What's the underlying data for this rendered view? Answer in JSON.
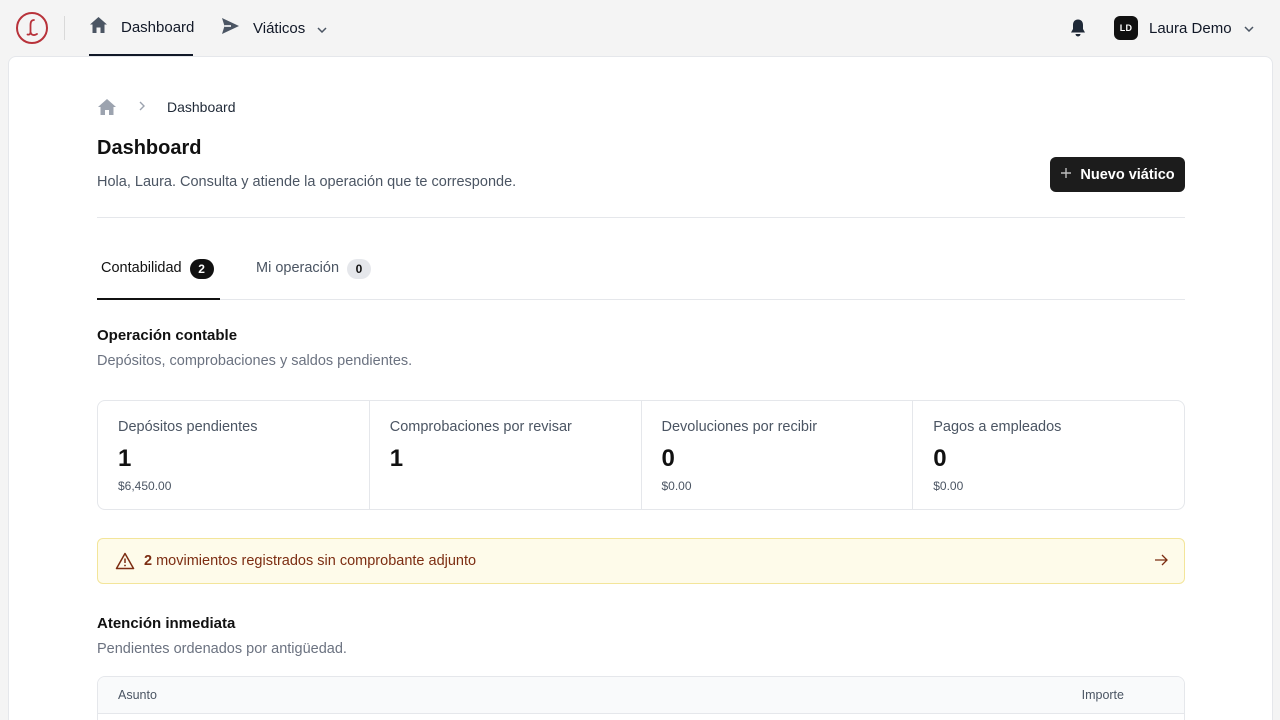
{
  "nav": {
    "items": [
      {
        "label": "Dashboard",
        "icon": "home-icon"
      },
      {
        "label": "Viáticos",
        "icon": "send-icon"
      }
    ],
    "user": {
      "initials": "LD",
      "name": "Laura Demo"
    }
  },
  "breadcrumb": {
    "current": "Dashboard"
  },
  "header": {
    "title": "Dashboard",
    "subtitle": "Hola, Laura. Consulta y atiende la operación que te corresponde.",
    "new_button": "Nuevo viático"
  },
  "tabs": [
    {
      "label": "Contabilidad",
      "count": "2"
    },
    {
      "label": "Mi operación",
      "count": "0"
    }
  ],
  "operacion": {
    "title": "Operación contable",
    "subtitle": "Depósitos, comprobaciones y saldos pendientes."
  },
  "stats": [
    {
      "label": "Depósitos pendientes",
      "value": "1",
      "amount": "$6,450.00"
    },
    {
      "label": "Comprobaciones por revisar",
      "value": "1",
      "amount": ""
    },
    {
      "label": "Devoluciones por recibir",
      "value": "0",
      "amount": "$0.00"
    },
    {
      "label": "Pagos a empleados",
      "value": "0",
      "amount": "$0.00"
    }
  ],
  "alert": {
    "count": "2",
    "text": " movimientos registrados sin comprobante adjunto"
  },
  "atencion": {
    "title": "Atención inmediata",
    "subtitle": "Pendientes ordenados por antigüedad."
  },
  "table": {
    "columns": [
      "Asunto",
      "Importe"
    ]
  },
  "colors": {
    "brand": "#b8323a",
    "primary": "#1c1c1c",
    "alert_bg": "#fefbea",
    "alert_text": "#7c2d12"
  }
}
